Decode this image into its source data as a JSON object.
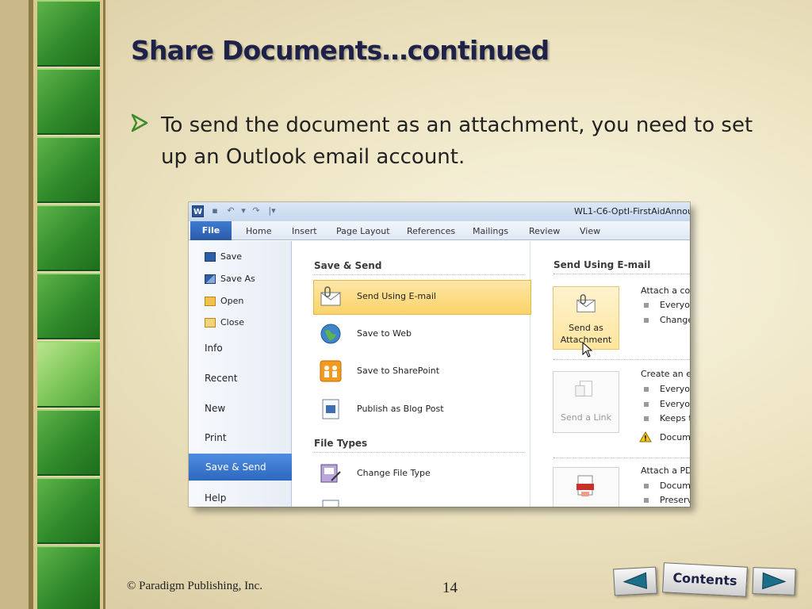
{
  "slide": {
    "title": "Share Documents…continued",
    "bullet": "To send the document as an attachment, you need to set up an Outlook email account.",
    "footer_copyright": "© Paradigm Publishing, Inc.",
    "page_number": "14",
    "contents_label": "Contents",
    "accent_color": "#1e2148",
    "strip_color": "#2f8a2a"
  },
  "screenshot": {
    "window_title": "WL1-C6-OptI-FirstAidAnnou",
    "app_logo": "W",
    "ribbon_tabs": [
      "File",
      "Home",
      "Insert",
      "Page Layout",
      "References",
      "Mailings",
      "Review",
      "View"
    ],
    "backstage_commands": [
      "Save",
      "Save As",
      "Open",
      "Close"
    ],
    "backstage_tabs": [
      "Info",
      "Recent",
      "New",
      "Print",
      "Save & Send",
      "Help"
    ],
    "selected_tab": "Save & Send",
    "save_send_header": "Save & Send",
    "save_send_options": [
      "Send Using E-mail",
      "Save to Web",
      "Save to SharePoint",
      "Publish as Blog Post"
    ],
    "file_types_header": "File Types",
    "file_type_options": [
      "Change File Type"
    ],
    "right_header": "Send Using E-mail",
    "attach_copy_text": "Attach a cop",
    "attach_bullets": [
      "Everyon",
      "Change"
    ],
    "send_as_attachment_label": "Send as Attachment",
    "create_email_text": "Create an e-",
    "link_bullets": [
      "Everyon",
      "Everyon",
      "Keeps t"
    ],
    "link_warning": "Docum",
    "send_link_label": "Send a Link",
    "attach_pdf_text": "Attach a PD",
    "pdf_bullets": [
      "Docum",
      "Preserv"
    ]
  }
}
